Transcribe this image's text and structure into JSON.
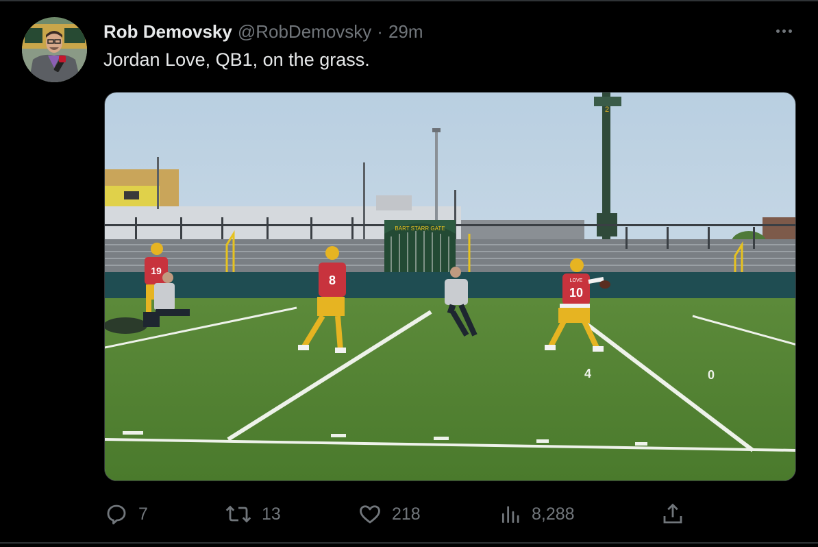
{
  "tweet": {
    "author_name": "Rob Demovsky",
    "handle": "@RobDemovsky",
    "separator": "·",
    "time": "29m",
    "text": "Jordan Love, QB1, on the grass."
  },
  "media": {
    "icon": "photo",
    "gate_sign": "BART STARR GATE",
    "pole_number": "2",
    "players": [
      {
        "number": "19"
      },
      {
        "number": "8"
      },
      {
        "number": "10",
        "name_on_jersey": "LOVE"
      }
    ],
    "yard_numbers": [
      "4",
      "0"
    ]
  },
  "actions": {
    "reply_count": "7",
    "retweet_count": "13",
    "like_count": "218",
    "view_count": "8,288"
  },
  "icons": {
    "reply": "speech-bubble",
    "retweet": "retweet-arrows",
    "like": "heart",
    "views": "bar-chart",
    "share": "upload-arrow",
    "more": "ellipsis"
  },
  "colors": {
    "background": "#000000",
    "text_primary": "#e7e9ea",
    "text_secondary": "#71767b",
    "packers_green": "#1f3d2c",
    "packers_gold": "#e6b422"
  }
}
